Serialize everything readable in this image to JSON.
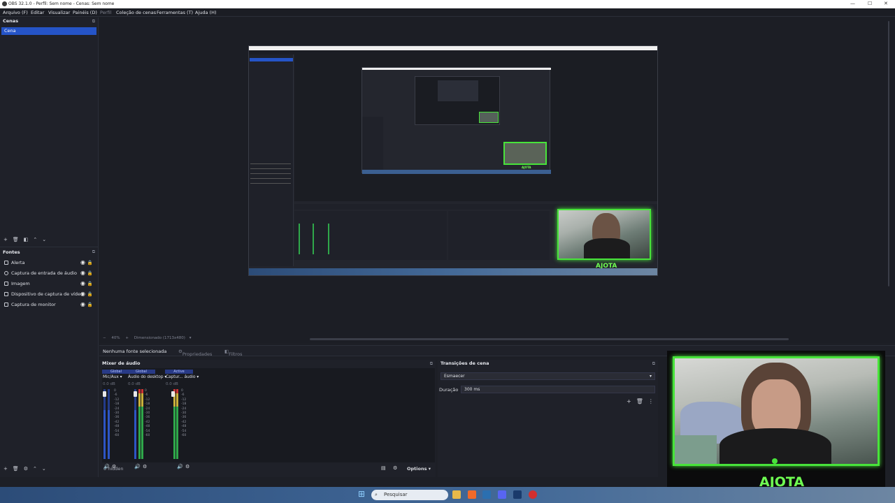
{
  "window": {
    "title": "OBS 32.1.0 - Perfil: Sem nome - Cenas: Sem nome"
  },
  "menu": [
    "Arquivo (F)",
    "Editar",
    "Visualizar",
    "Painéis (D)",
    "Perfil",
    "Coleção de cenas",
    "Ferramentas (T)",
    "Ajuda (H)"
  ],
  "scenes": {
    "title": "Cenas",
    "items": [
      "Cena"
    ]
  },
  "sources": {
    "title": "Fontes",
    "items": [
      {
        "label": "Alerta",
        "icon": "image-icon"
      },
      {
        "label": "Captura de entrada de áudio",
        "icon": "microphone-icon"
      },
      {
        "label": "Imagem",
        "icon": "image-icon"
      },
      {
        "label": "Dispositivo de captura de vídeo",
        "icon": "camera-icon"
      },
      {
        "label": "Captura de monitor",
        "icon": "monitor-icon"
      }
    ]
  },
  "context": {
    "no_source": "Nenhuma fonte selecionada",
    "properties": "Propriedades",
    "filters": "Filtros"
  },
  "preview": {
    "zoom": "40%",
    "scale_mode": "Dimensionado (1713x480)"
  },
  "mixer": {
    "title": "Mixer de áudio",
    "channels": [
      {
        "badge": "Global",
        "name": "Mic/Aux",
        "db": "0.0 dB"
      },
      {
        "badge": "Global",
        "name": "Áudio do desktop",
        "db": "0.0 dB"
      },
      {
        "badge": "Active",
        "name": "Captur... áudio",
        "db": "0.0 dB"
      }
    ],
    "scale": [
      "0",
      "-6",
      "-12",
      "-18",
      "-24",
      "-30",
      "-36",
      "-42",
      "-48",
      "-54",
      "-60"
    ],
    "hidden": "0 hidden",
    "options": "Options"
  },
  "transitions": {
    "title": "Transições de cena",
    "selected": "Esmaecer",
    "duration_label": "Duração",
    "duration_value": "300 ms"
  },
  "overlay": {
    "name": "AJOTA"
  },
  "taskbar": {
    "search_placeholder": "Pesquisar"
  },
  "colors": {
    "accent": "#2554c7",
    "overlay_green": "#48e43a",
    "bg": "#1d1f26"
  }
}
